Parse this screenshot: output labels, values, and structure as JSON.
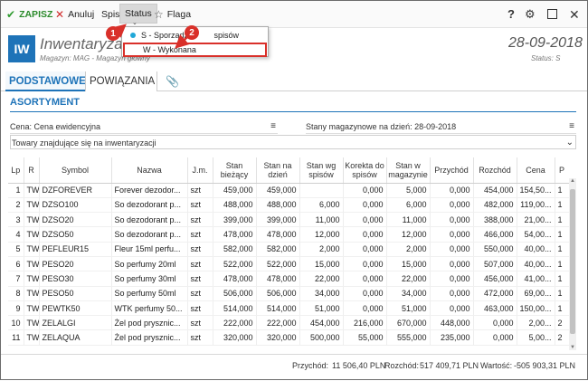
{
  "toolbar": {
    "save_label": "ZAPISZ",
    "cancel_label": "Anuluj",
    "spis_label": "Spis",
    "status_label": "Status",
    "flaga_label": "Flaga",
    "save_icon": "check-icon",
    "cancel_icon": "x-icon",
    "flaga_icon": "star-icon",
    "help_label": "?"
  },
  "status_menu": {
    "items": [
      {
        "label": "S - Sporządz",
        "label_tail": "spisów",
        "selected": true
      },
      {
        "label": "W - Wykonana",
        "selected": false
      }
    ]
  },
  "header": {
    "logo": "IW",
    "title": "Inwentaryzacja",
    "subtitle": "Magazyn: MAG - Magazyn główny",
    "date": "28-09-2018",
    "status": "Status: S"
  },
  "tabs": {
    "primary": "PODSTAWOWE",
    "secondary": "POWIĄZANIA",
    "attachment_icon": "paperclip-icon"
  },
  "section_title": "ASORTYMENT",
  "filters": {
    "cena": "Cena: Cena ewidencyjna",
    "stany": "Stany magazynowe na dzień: 28-09-2018",
    "towary": "Towary znajdujące się na inwentaryzacji"
  },
  "table": {
    "columns": [
      "Lp",
      "R",
      "Symbol",
      "Nazwa",
      "J.m.",
      "Stan bieżący",
      "Stan na dzień",
      "Stan wg spisów",
      "Korekta do spisów",
      "Stan w magazynie",
      "Przychód",
      "Rozchód",
      "Cena",
      "P"
    ],
    "rows": [
      [
        "1",
        "TW",
        "DZFOREVER",
        "Forever dezodor...",
        "szt",
        "459,000",
        "459,000",
        "0,000",
        "5,000",
        "0,000",
        "454,000",
        "154,50...",
        "1"
      ],
      [
        "2",
        "TW",
        "DZSO100",
        "So dezodorant p...",
        "szt",
        "488,000",
        "488,000",
        "6,000",
        "0,000",
        "6,000",
        "0,000",
        "482,000",
        "119,00...",
        "1"
      ],
      [
        "3",
        "TW",
        "DZSO20",
        "So dezodorant p...",
        "szt",
        "399,000",
        "399,000",
        "11,000",
        "0,000",
        "11,000",
        "0,000",
        "388,000",
        "21,00...",
        "1"
      ],
      [
        "4",
        "TW",
        "DZSO50",
        "So dezodorant p...",
        "szt",
        "478,000",
        "478,000",
        "12,000",
        "0,000",
        "12,000",
        "0,000",
        "466,000",
        "54,00...",
        "1"
      ],
      [
        "5",
        "TW",
        "PEFLEUR15",
        "Fleur 15ml perfu...",
        "szt",
        "582,000",
        "582,000",
        "2,000",
        "0,000",
        "2,000",
        "0,000",
        "550,000",
        "40,00...",
        "1"
      ],
      [
        "6",
        "TW",
        "PESO20",
        "So perfumy 20ml",
        "szt",
        "522,000",
        "522,000",
        "15,000",
        "0,000",
        "15,000",
        "0,000",
        "507,000",
        "40,00...",
        "1"
      ],
      [
        "7",
        "TW",
        "PESO30",
        "So perfumy 30ml",
        "szt",
        "478,000",
        "478,000",
        "22,000",
        "0,000",
        "22,000",
        "0,000",
        "456,000",
        "41,00...",
        "1"
      ],
      [
        "8",
        "TW",
        "PESO50",
        "So perfumy 50ml",
        "szt",
        "506,000",
        "506,000",
        "34,000",
        "0,000",
        "34,000",
        "0,000",
        "472,000",
        "69,00...",
        "1"
      ],
      [
        "9",
        "TW",
        "PEWTK50",
        "WTK perfumy 50...",
        "szt",
        "514,000",
        "514,000",
        "51,000",
        "0,000",
        "51,000",
        "0,000",
        "463,000",
        "150,00...",
        "1"
      ],
      [
        "10",
        "TW",
        "ZELALGI",
        "Żel pod prysznic...",
        "szt",
        "222,000",
        "222,000",
        "454,000",
        "216,000",
        "670,000",
        "448,000",
        "0,000",
        "2,00...",
        "2"
      ],
      [
        "11",
        "TW",
        "ZELAQUA",
        "Żel pod prysznic...",
        "szt",
        "320,000",
        "320,000",
        "500,000",
        "55,000",
        "555,000",
        "235,000",
        "0,000",
        "5,00...",
        "2"
      ]
    ]
  },
  "footer": {
    "przychod_label": "Przychód:",
    "przychod_value": "11 506,40 PLN",
    "rozchod_label": "Rozchód:",
    "rozchod_value": "517 409,71 PLN",
    "wartosc_label": "Wartość:",
    "wartosc_value": "-505 903,31 PLN"
  },
  "annotations": {
    "step1": "1",
    "step2": "2",
    "color": "#d9302a"
  },
  "colors": {
    "accent": "#1e73b8",
    "save": "#2f9b2f",
    "cancel": "#d12b2b"
  }
}
